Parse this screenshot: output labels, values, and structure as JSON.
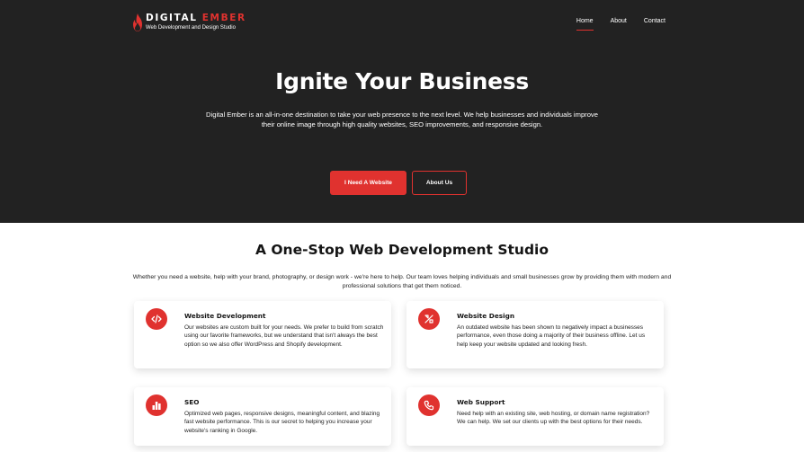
{
  "brand": {
    "name_part1": "DIGITAL ",
    "name_part2": "EMBER",
    "tagline": "Web Development and Design Studio",
    "accent_color": "#e0322f",
    "hero_bg": "#222222"
  },
  "nav": {
    "items": [
      {
        "label": "Home",
        "active": true
      },
      {
        "label": "About",
        "active": false
      },
      {
        "label": "Contact",
        "active": false
      }
    ]
  },
  "hero": {
    "title": "Ignite Your Business",
    "description": "Digital Ember is an all-in-one destination to take your web presence to the next level. We help businesses and individuals improve their online image through high quality websites, SEO improvements, and responsive design.",
    "primary_button": "I Need A Website",
    "secondary_button": "About Us"
  },
  "services": {
    "title": "A One-Stop Web Development Studio",
    "description": "Whether you need a website, help with your brand, photography, or design work - we're here to help. Our team loves helping individuals and small businesses grow by providing them with modern and professional solutions that get them noticed.",
    "cards": [
      {
        "icon": "code-icon",
        "title": "Website Development",
        "text": "Our websites are custom built for your needs. We prefer to build from scratch using our favorite frameworks, but we understand that isn't always the best option so we also offer WordPress and Shopify development."
      },
      {
        "icon": "design-tools-icon",
        "title": "Website Design",
        "text": "An outdated website has been shown to negatively impact a businesses performance, even those doing a majority of their business offline. Let us help keep your website updated and looking fresh."
      },
      {
        "icon": "bar-chart-icon",
        "title": "SEO",
        "text": "Optimized web pages, responsive designs, meaningful content, and blazing fast website performance. This is our secret to helping you increase your website's ranking in Google."
      },
      {
        "icon": "phone-icon",
        "title": "Web Support",
        "text": "Need help with an existing site, web hosting, or domain name registration? We can help. We set our clients up with the best options for their needs."
      }
    ]
  }
}
